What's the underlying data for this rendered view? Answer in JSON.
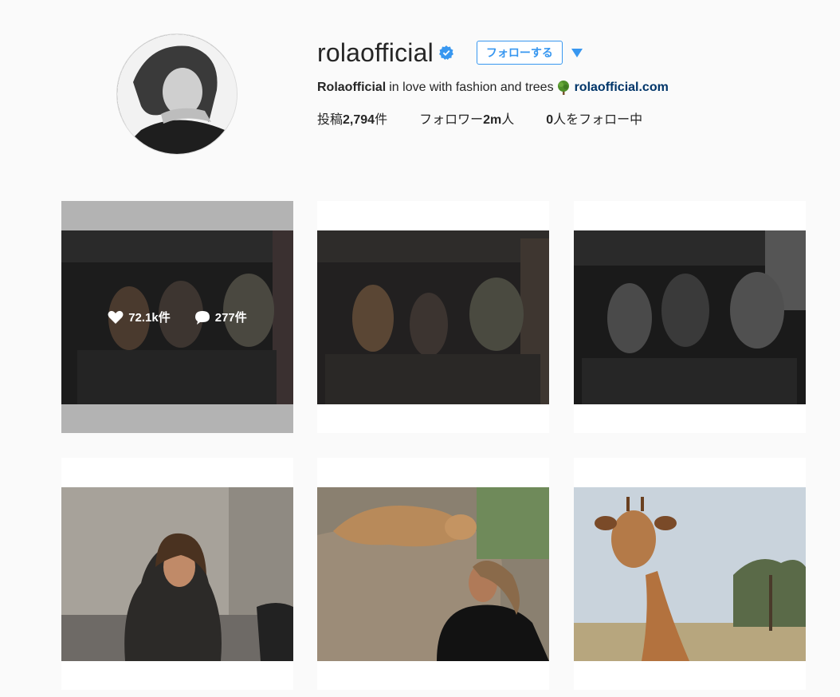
{
  "profile": {
    "username": "rolaofficial",
    "follow_label": "フォローする",
    "bio_name": "Rolaofficial",
    "bio_text": "in love with fashion and trees",
    "website": "rolaofficial.com"
  },
  "stats": {
    "posts_prefix": "投稿",
    "posts_count": "2,794",
    "posts_suffix": "件",
    "followers_label": "フォロワー",
    "followers_count": "2m",
    "followers_suffix": "人",
    "following_count": "0",
    "following_suffix": "人をフォロー中"
  },
  "posts": [
    {
      "likes": "72.1k件",
      "comments": "277件"
    }
  ],
  "colors": {
    "accent": "#3897f0",
    "link": "#003569",
    "verified": "#3897f0",
    "hover_frame": "#b3b3b3"
  },
  "icons": [
    "verified-badge-icon",
    "chevron-down-icon",
    "tree-emoji-icon",
    "heart-icon",
    "comment-icon"
  ]
}
